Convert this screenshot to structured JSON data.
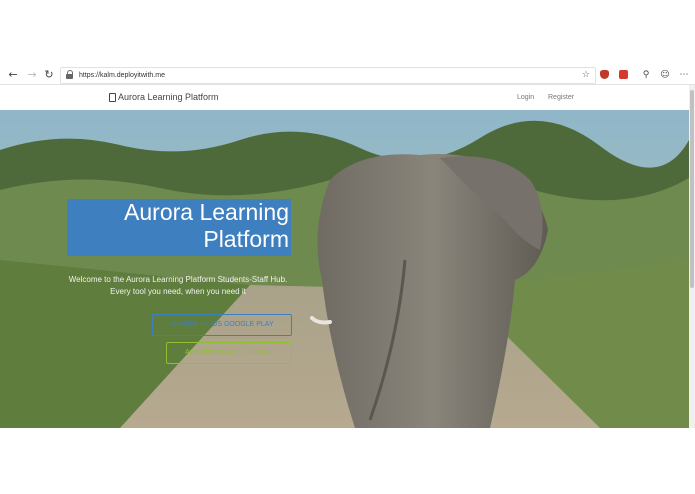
{
  "browser": {
    "url": "https://kalm.deployitwith.me",
    "icons": {
      "back": "back-arrow-icon",
      "forward": "forward-arrow-icon",
      "refresh": "refresh-icon",
      "lock": "lock-icon",
      "favorite": "star-icon",
      "profile": "profile-icon",
      "emoji": "smiley-icon",
      "menu": "more-dots-icon"
    }
  },
  "header": {
    "brand": "Aurora Learning Platform",
    "login": "Login",
    "register": "Register"
  },
  "hero": {
    "title_line1": "Aurora Learning",
    "title_line2": "Platform",
    "subtitle": "Welcome to the Aurora Learning Platform Students-Staff Hub. Every tool you need, when you need it",
    "btn_primary": "Available on iOS GOOGLE PLAY",
    "btn_secondary": "Available on APPLE STORE"
  },
  "colors": {
    "accent_blue": "#3e7fc0",
    "accent_green": "#8fc12f"
  }
}
